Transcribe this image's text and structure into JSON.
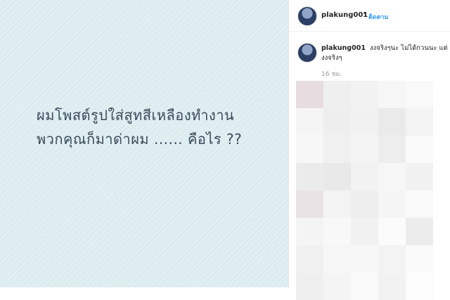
{
  "post": {
    "caption_lines": [
      "ผมโพสต์รูปใส่สูทสีเหลืองทำงาน",
      "พวกคุณก็มาด่าผม ...... คือไร ??"
    ]
  },
  "header": {
    "username": "plakung001",
    "separator": "•",
    "follow_label": "ติดตาม"
  },
  "comment": {
    "username": "plakung001",
    "text": "งงจริงๆนะ ไม่ได้กวนนะ แต่งงจริงๆ",
    "timestamp": "16 ชม."
  },
  "mosaic": {
    "colors": [
      "#e7dcdf",
      "#efefef",
      "#f2f2f2",
      "#f6f6f6",
      "#f9f9f9",
      "#f5f5f5",
      "#eeeeee",
      "#f1f1f1",
      "#eaeaea",
      "#f3f3f3",
      "#f7f7f7",
      "#f0f0f0",
      "#f4f4f4",
      "#ededed",
      "#fafafa",
      "#ebebeb",
      "#e9e9e9",
      "#f2f2f2",
      "#f6f6f6",
      "#f1f1f1",
      "#e8e2e4",
      "#f3f3f3",
      "#eeeeee",
      "#f5f5f5",
      "#f9f9f9",
      "#f4f4f4",
      "#f8f8f8",
      "#f1f1f1",
      "#fbfbfb",
      "#ececec",
      "#f0f0f0",
      "#f6f6f6",
      "#f7f7f7",
      "#f3f3f3",
      "#fafafa",
      "#efefef",
      "#f4f4f4",
      "#f9f9f9",
      "#f2f2f2",
      "#fcfcfc"
    ]
  }
}
